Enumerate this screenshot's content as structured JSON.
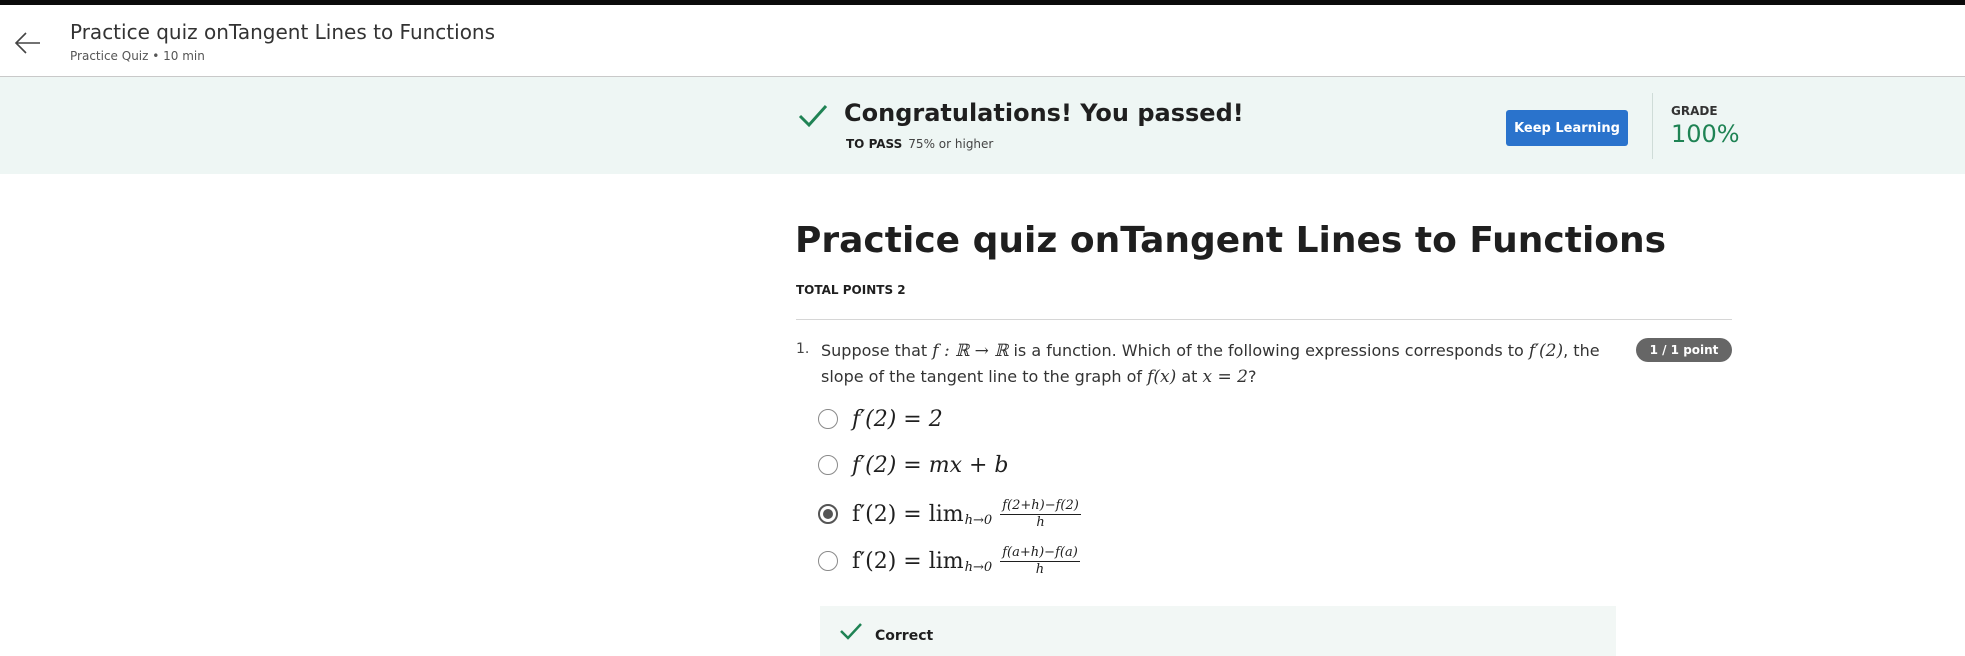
{
  "header": {
    "title": "Practice quiz onTangent Lines to Functions",
    "subtitle": "Practice Quiz • 10 min"
  },
  "banner": {
    "message": "Congratulations! You passed!",
    "to_pass_label": "TO PASS",
    "to_pass_value": "75% or higher",
    "keep_learning_label": "Keep Learning",
    "grade_label": "GRADE",
    "grade_value": "100%",
    "accent_color": "#1f8354",
    "button_color": "#2a73cc"
  },
  "quiz": {
    "title": "Practice quiz onTangent Lines to Functions",
    "total_points": "TOTAL POINTS 2"
  },
  "question": {
    "number": "1.",
    "points_badge": "1 / 1 point",
    "text_part1": "Suppose that ",
    "text_math1": "f : ℝ → ℝ",
    "text_part2": " is a function. Which of the following expressions corresponds to ",
    "text_math2": "f′(2)",
    "text_part3": ", the slope of the tangent line to the graph of ",
    "text_math3": "f(x)",
    "text_part4": " at ",
    "text_math4": "x = 2",
    "text_part5": "?",
    "options": [
      {
        "math": "f′(2) = 2",
        "selected": false
      },
      {
        "math": "f′(2) = mx + b",
        "selected": false
      },
      {
        "lhs": "f′(2) = lim",
        "sub": "h→0",
        "num": "f(2+h)−f(2)",
        "den": "h",
        "selected": true
      },
      {
        "lhs": "f′(2) = lim",
        "sub": "h→0",
        "num": "f(a+h)−f(a)",
        "den": "h",
        "selected": false
      }
    ],
    "feedback": "Correct"
  }
}
